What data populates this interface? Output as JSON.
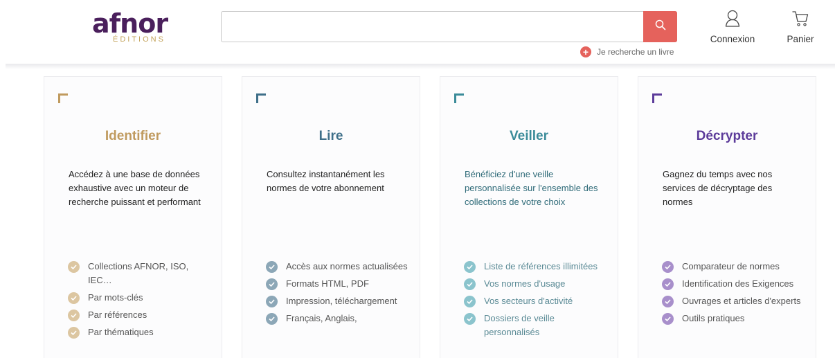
{
  "header": {
    "logo": {
      "word": "afnor",
      "sub": "ÉDITIONS"
    },
    "search": {
      "value": "",
      "placeholder": ""
    },
    "book_link": "Je recherche un livre",
    "login_label": "Connexion",
    "cart_label": "Panier"
  },
  "colors": {
    "accent_red": "#e5625c",
    "identifier": "#c09a5e",
    "lire": "#3e6f89",
    "veiller": "#3a8b99",
    "decrypter": "#5c3b9a"
  },
  "cards": [
    {
      "title": "Identifier",
      "description": "Accédez à une base de données exhaustive avec un moteur de recherche puissant et performant",
      "features": [
        "Collections AFNOR, ISO, IEC…",
        "Par mots-clés",
        "Par références",
        "Par thématiques"
      ]
    },
    {
      "title": "Lire",
      "description": "Consultez instantanément les normes de votre abonnement",
      "features": [
        "Accès aux normes actualisées",
        "Formats HTML, PDF",
        "Impression, téléchargement",
        "Français, Anglais,"
      ]
    },
    {
      "title": "Veiller",
      "description": "Bénéficiez d'une veille personnalisée sur l'ensemble des collections de votre choix",
      "features": [
        "Liste de références illimitées",
        "Vos normes d'usage",
        "Vos secteurs d'activité",
        "Dossiers de veille personnalisés"
      ]
    },
    {
      "title": "Décrypter",
      "description": "Gagnez du temps avec nos services de décryptage des normes",
      "features": [
        "Comparateur de normes",
        "Identification des Exigences",
        "Ouvrages et articles d'experts",
        "Outils pratiques"
      ]
    }
  ],
  "icons": [
    "search-icon",
    "plus-icon",
    "user-icon",
    "cart-icon",
    "check-icon",
    "corner-bracket-icon"
  ]
}
